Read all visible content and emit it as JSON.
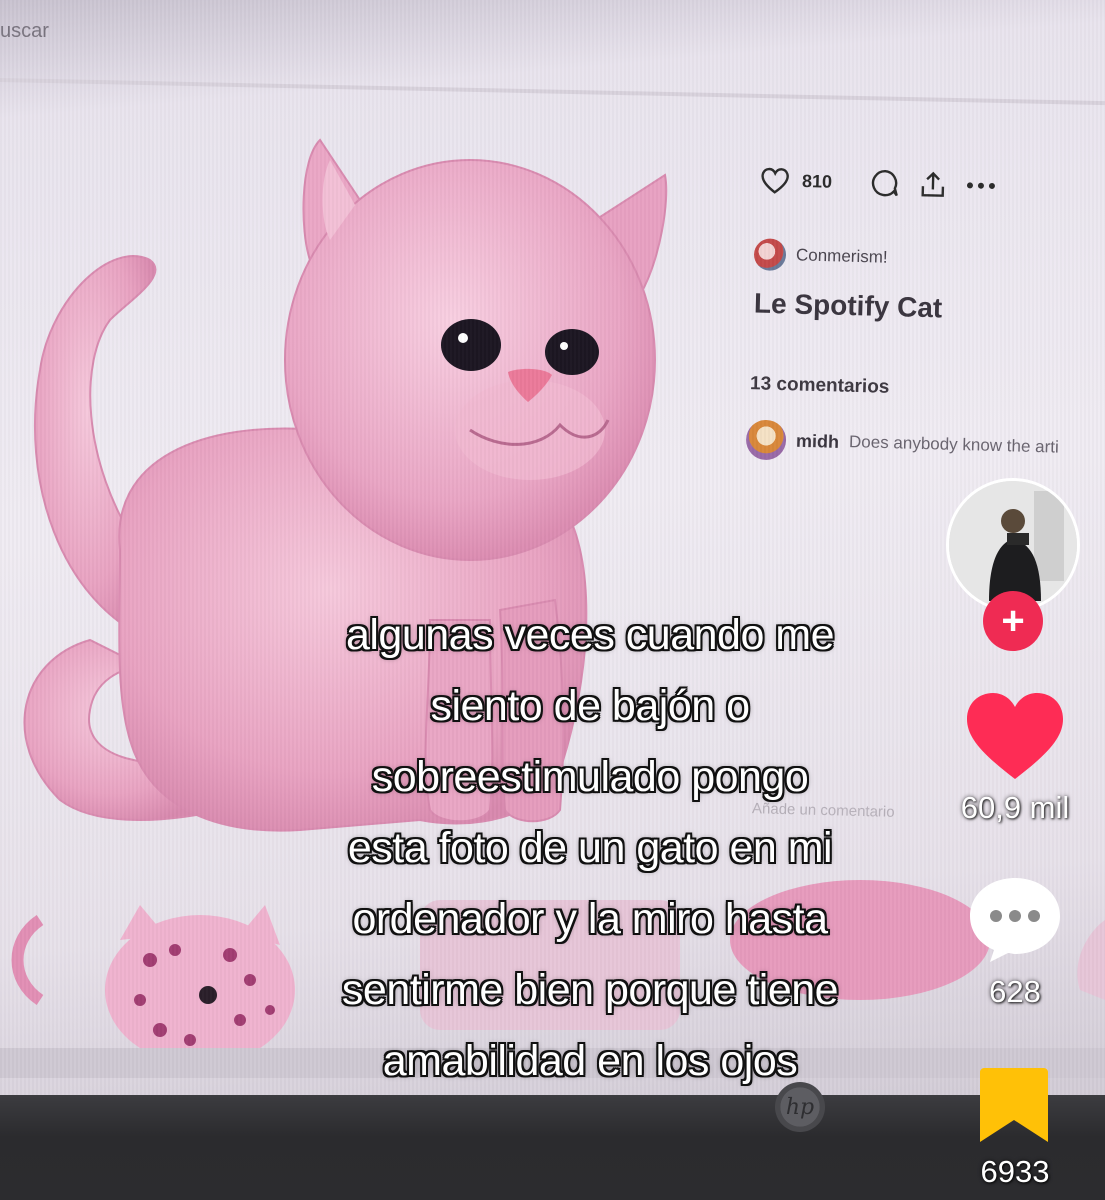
{
  "browser": {
    "search_text": "uscar"
  },
  "pin": {
    "like_count": "810",
    "author": "Conmerism!",
    "title": "Le Spotify Cat",
    "comments_count": "13 comentarios",
    "first_comment": {
      "user": "midh",
      "text": "Does anybody know the arti"
    },
    "add_comment_placeholder": "Añade un comentario",
    "icons": [
      "heart-outline-icon",
      "comment-bubble-icon",
      "share-icon",
      "more-icon"
    ]
  },
  "tiktok": {
    "caption_lines": [
      "algunas veces cuando me",
      "siento de bajón o",
      "sobreestimulado pongo",
      "esta foto de un gato en mi",
      "ordenador y la miro hasta",
      "sentirme bien porque tiene",
      "amabilidad en los ojos"
    ],
    "likes": "60,9 mil",
    "comments": "628",
    "saves": "6933",
    "follow_symbol": "+",
    "colors": {
      "like": "#fe2c55",
      "save": "#ffc107",
      "follow": "#ef2b53"
    }
  },
  "monitor": {
    "brand": "hp"
  }
}
